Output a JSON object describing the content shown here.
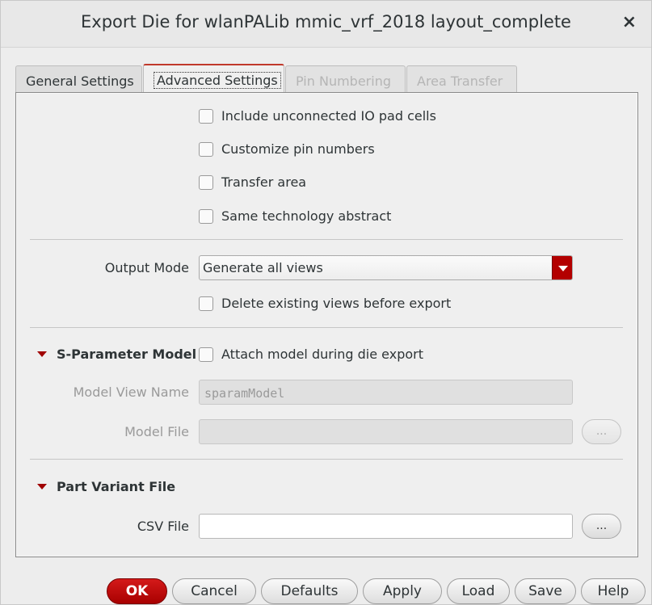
{
  "window": {
    "title": "Export Die for wlanPALib mmic_vrf_2018 layout_complete",
    "close_glyph": "×"
  },
  "tabs": [
    {
      "label": "General Settings",
      "state": "normal"
    },
    {
      "label": "Advanced Settings",
      "state": "active"
    },
    {
      "label": "Pin Numbering",
      "state": "disabled"
    },
    {
      "label": "Area Transfer",
      "state": "disabled"
    }
  ],
  "options": {
    "include_unconnected": "Include unconnected IO pad cells",
    "customize_pin_numbers": "Customize pin numbers",
    "transfer_area": "Transfer area",
    "same_tech_abstract": "Same technology abstract"
  },
  "output_mode": {
    "label": "Output Mode",
    "value": "Generate all views",
    "delete_existing": "Delete existing views before export"
  },
  "sparam": {
    "title": "S-Parameter Model",
    "attach_label": "Attach model during die export",
    "model_view_name_label": "Model View Name",
    "model_view_name_value": "sparamModel",
    "model_file_label": "Model File",
    "model_file_value": "",
    "browse": "..."
  },
  "part_variant": {
    "title": "Part Variant File",
    "csv_label": "CSV File",
    "csv_value": "",
    "browse": "..."
  },
  "buttons": {
    "ok": "OK",
    "cancel": "Cancel",
    "defaults": "Defaults",
    "apply": "Apply",
    "load": "Load",
    "save": "Save",
    "help": "Help"
  },
  "colors": {
    "accent": "#b30000",
    "panel_bg": "#efefef"
  }
}
